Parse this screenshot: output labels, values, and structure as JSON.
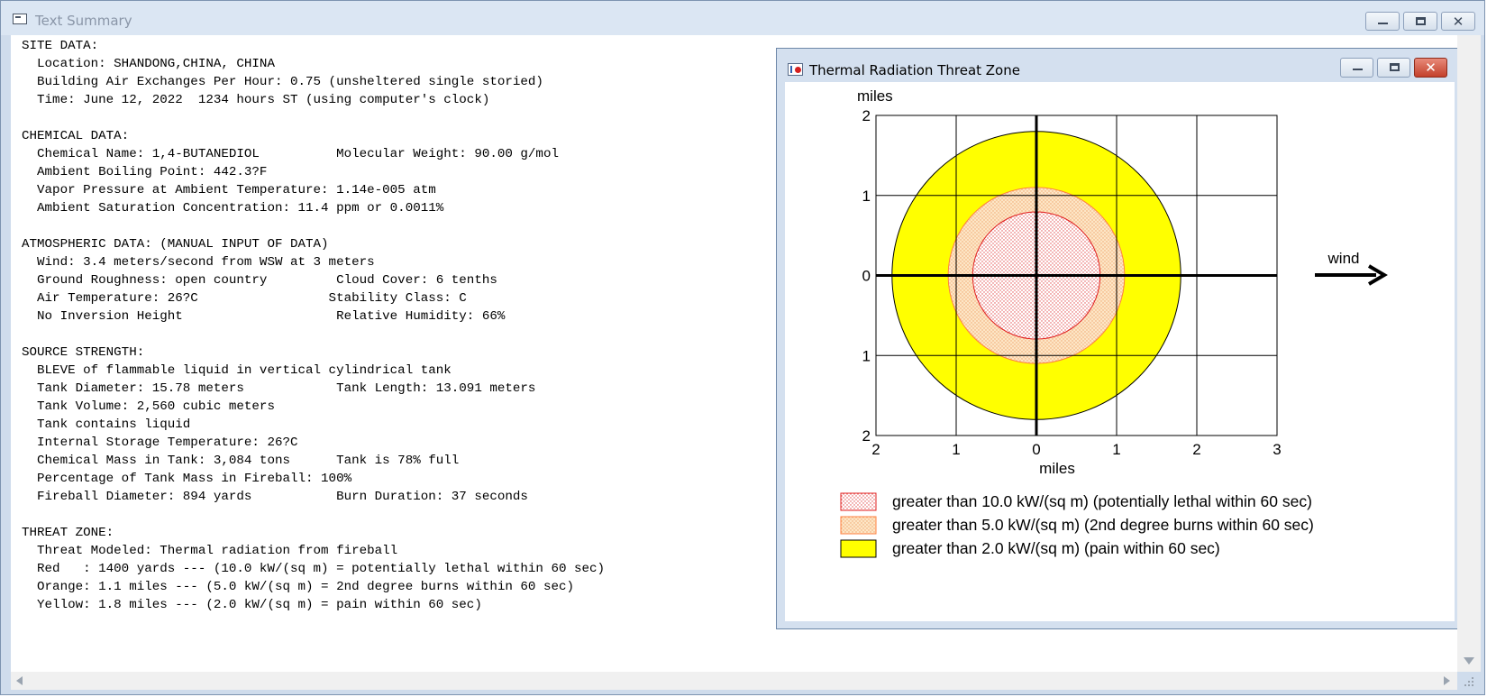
{
  "window": {
    "title": "Text Summary"
  },
  "summary_lines": [
    "SITE DATA:",
    "  Location: SHANDONG,CHINA, CHINA",
    "  Building Air Exchanges Per Hour: 0.75 (unsheltered single storied)",
    "  Time: June 12, 2022  1234 hours ST (using computer's clock)",
    "",
    "CHEMICAL DATA:",
    "  Chemical Name: 1,4-BUTANEDIOL          Molecular Weight: 90.00 g/mol",
    "  Ambient Boiling Point: 442.3?F",
    "  Vapor Pressure at Ambient Temperature: 1.14e-005 atm",
    "  Ambient Saturation Concentration: 11.4 ppm or 0.0011%",
    "",
    "ATMOSPHERIC DATA: (MANUAL INPUT OF DATA)",
    "  Wind: 3.4 meters/second from WSW at 3 meters",
    "  Ground Roughness: open country         Cloud Cover: 6 tenths",
    "  Air Temperature: 26?C                 Stability Class: C",
    "  No Inversion Height                    Relative Humidity: 66%",
    "",
    "SOURCE STRENGTH:",
    "  BLEVE of flammable liquid in vertical cylindrical tank",
    "  Tank Diameter: 15.78 meters            Tank Length: 13.091 meters",
    "  Tank Volume: 2,560 cubic meters",
    "  Tank contains liquid",
    "  Internal Storage Temperature: 26?C",
    "  Chemical Mass in Tank: 3,084 tons      Tank is 78% full",
    "  Percentage of Tank Mass in Fireball: 100%",
    "  Fireball Diameter: 894 yards           Burn Duration: 37 seconds",
    "",
    "THREAT ZONE:",
    "  Threat Modeled: Thermal radiation from fireball",
    "  Red   : 1400 yards --- (10.0 kW/(sq m) = potentially lethal within 60 sec)",
    "  Orange: 1.1 miles --- (5.0 kW/(sq m) = 2nd degree burns within 60 sec)",
    "  Yellow: 1.8 miles --- (2.0 kW/(sq m) = pain within 60 sec)"
  ],
  "threat_window": {
    "title": "Thermal Radiation Threat Zone"
  },
  "chart_data": {
    "type": "threat-zone-map",
    "xlabel": "miles",
    "ylabel": "miles",
    "xlim": [
      -2,
      3
    ],
    "ylim": [
      -2,
      2
    ],
    "x_ticks": [
      -2,
      -1,
      0,
      1,
      2,
      3
    ],
    "x_tick_labels": [
      "2",
      "1",
      "0",
      "1",
      "2",
      "3"
    ],
    "y_ticks": [
      2,
      1,
      0,
      -1,
      -2
    ],
    "y_tick_labels": [
      "2",
      "1",
      "0",
      "1",
      "2"
    ],
    "grid": true,
    "wind_label": "wind",
    "wind_direction": "east",
    "zones": [
      {
        "name": "Yellow",
        "radius_miles": 1.8,
        "fill": "#ffff00",
        "stroke": "#000000",
        "pattern": "solid",
        "legend": "greater than 2.0 kW/(sq m) (pain within 60 sec)"
      },
      {
        "name": "Orange",
        "radius_miles": 1.1,
        "fill": "#fddab0",
        "stroke": "#ff8040",
        "pattern": "dotted",
        "legend": "greater than 5.0 kW/(sq m) (2nd degree burns within 60 sec)"
      },
      {
        "name": "Red",
        "radius_miles": 0.795,
        "fill": "#fde4e4",
        "stroke": "#e02020",
        "pattern": "dotted",
        "legend": "greater than 10.0 kW/(sq m) (potentially lethal within 60 sec)"
      }
    ],
    "legend_order": [
      "Red",
      "Orange",
      "Yellow"
    ]
  }
}
